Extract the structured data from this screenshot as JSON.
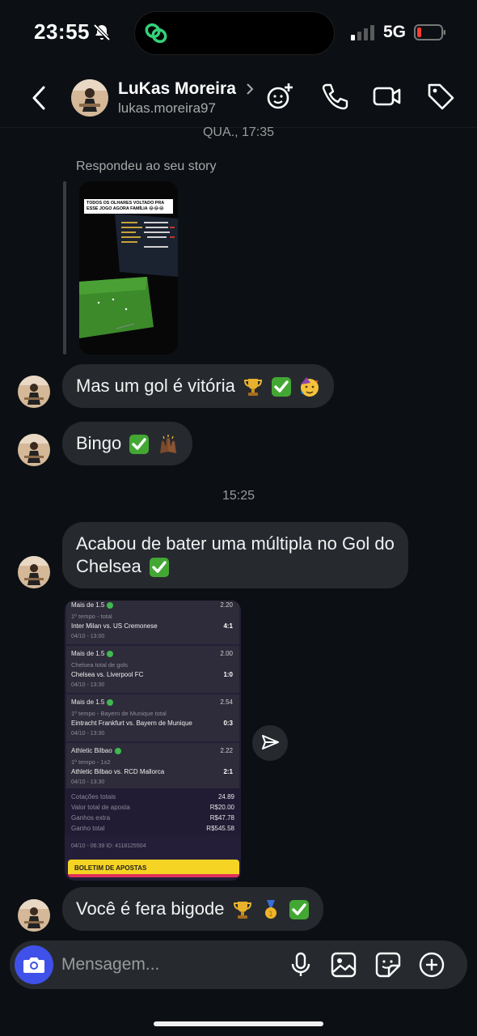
{
  "status_bar": {
    "time": "23:55",
    "network": "5G",
    "battery_color": "#ff3b30"
  },
  "header": {
    "name": "LuKas Moreira",
    "username": "lukas.moreira97"
  },
  "conversation": {
    "timestamp_1": "QUA., 17:35",
    "reply_label": "Respondeu ao seu story",
    "story_caption": "TODOS OS OLHARES VOLTADO PRA ESSE JOGO AGORA FAMÍLIA 😂😂😂",
    "msg_1": "Mas um gol é vitória",
    "msg_2": "Bingo",
    "timestamp_2": "15:25",
    "msg_3_line1": "Acabou de bater uma múltipla no Gol do",
    "msg_3_line2": "Chelsea",
    "msg_4": "Você é fera bigode"
  },
  "bet_slip": {
    "legs": [
      {
        "name": "Mais de 1.5",
        "odd": "2.20",
        "market": "1º tempo - total",
        "match": "Inter Milan vs. US Cremonese",
        "score": "4:1",
        "time": "04/10 - 13:00"
      },
      {
        "name": "Mais de 1.5",
        "odd": "2.00",
        "market": "Chelsea total de gols",
        "match": "Chelsea vs. Liverpool FC",
        "score": "1:0",
        "time": "04/10 - 13:30"
      },
      {
        "name": "Mais de 1.5",
        "odd": "2.54",
        "market": "1º tempo - Bayern de Munique total",
        "match": "Eintracht Frankfurt vs. Bayern de Munique",
        "score": "0:3",
        "time": "04/10 - 13:30"
      },
      {
        "name": "Athletic Bilbao",
        "odd": "2.22",
        "market": "1º tempo - 1x2",
        "match": "Athletic Bilbao vs. RCD Mallorca",
        "score": "2:1",
        "time": "04/10 - 13:30"
      }
    ],
    "summary": [
      {
        "label": "Cotações totais",
        "value": "24.89"
      },
      {
        "label": "Valor total de aposta",
        "value": "R$20.00"
      },
      {
        "label": "Ganhos extra",
        "value": "R$47.78"
      },
      {
        "label": "Ganho total",
        "value": "R$545.58"
      }
    ],
    "meta": "04/10 - 06:39   ID: 4118125504",
    "button": "BOLETIM DE APOSTAS"
  },
  "composer": {
    "placeholder": "Mensagem..."
  },
  "colors": {
    "background": "#0c1014",
    "bubble": "#262a2f",
    "accent": "#3f51e8",
    "check_green": "#3fb950"
  }
}
